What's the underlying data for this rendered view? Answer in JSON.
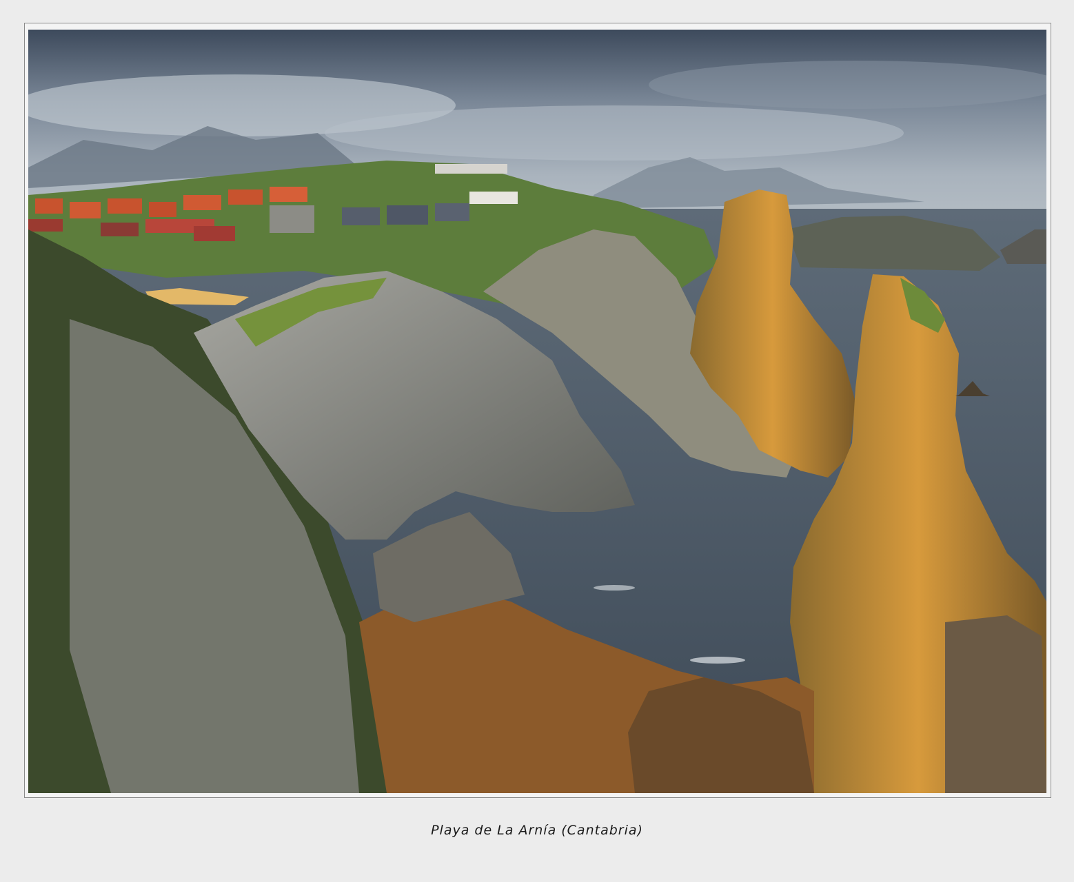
{
  "caption": "Playa de La Arnía (Cantabria)"
}
